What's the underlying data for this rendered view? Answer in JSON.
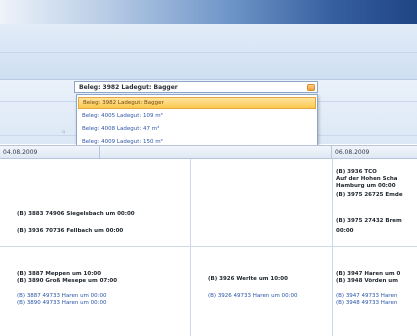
{
  "combo": {
    "value": "Beleg: 3982 Ladegut: Bagger"
  },
  "dropdown": {
    "options": [
      "Beleg: 3982 Ladegut: Bagger",
      "Beleg: 4005 Ladegut: 109 m³",
      "Beleg: 4008 Ladegut: 47 m³",
      "Beleg: 4009 Ladegut: 150 m³"
    ],
    "selected_index": 0
  },
  "dates": {
    "col1": "04.08.2009",
    "col3": "06.08.2009"
  },
  "events": {
    "c1r1a": "(B) 3883 74906 Siegelsbach um 00:00",
    "c1r1b": "(B) 3936 70736 Fellbach um 00:00",
    "c3r1a": "(B) 3936 TCO",
    "c3r1b": "Auf der Hohen Scha",
    "c3r1c": "Hamburg um 00:00",
    "c3r1d": "(B) 3975 26725 Emde",
    "c3r1e": "(B) 3975 27432 Brem",
    "c3r1f": "00:00",
    "c1r2a": "(B) 3887 Meppen um 10:00",
    "c1r2b": "(B) 3890 Groß Mesepe um 07:00",
    "c1r2c": "(B) 3887 49733 Haren um 00:00",
    "c1r2d": "(B) 3890 49733 Haren um 00:00",
    "c2r2a": "(B) 3926 Werlte um 10:00",
    "c2r2b": "(B) 3926 49733 Haren um 00:00",
    "c3r2a": "(B) 3947 Haren um 0",
    "c3r2b": "(B) 3948 Vörden um",
    "c3r2c": "(B) 3947 49733 Haren",
    "c3r2d": "(B) 3948 49733 Haren"
  },
  "colors": {
    "selection": "#ffc84e",
    "link_text": "#2a55a7",
    "titlebar_dark": "#1f4584"
  }
}
